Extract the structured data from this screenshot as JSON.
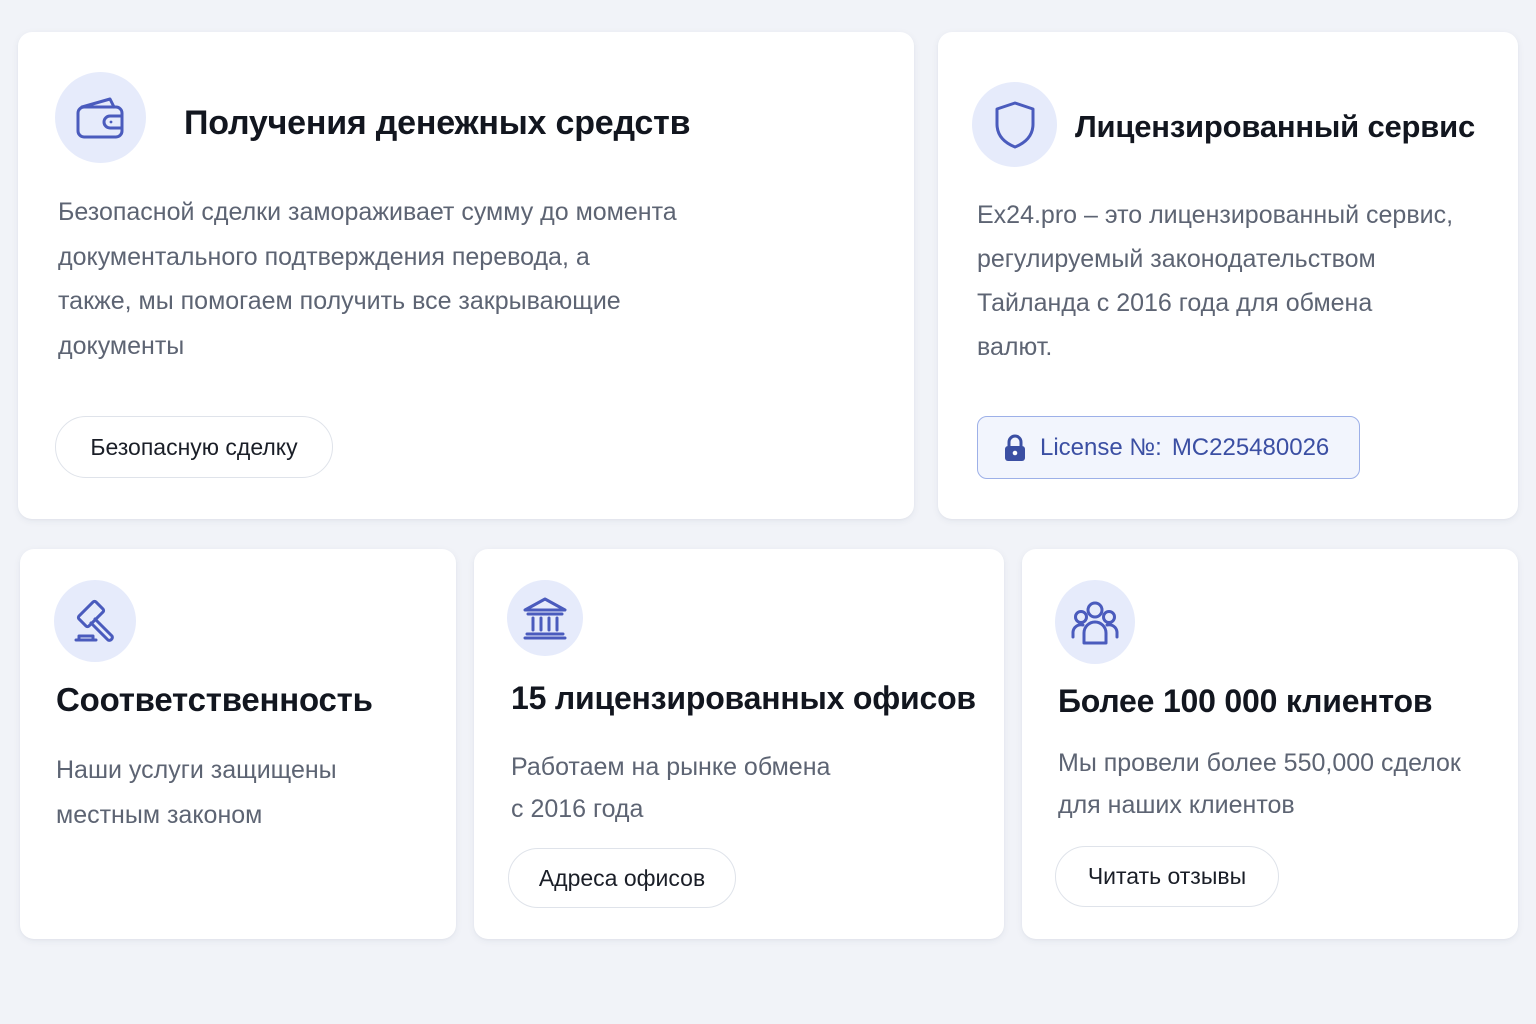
{
  "colors": {
    "background": "#f1f3f8",
    "card": "#ffffff",
    "icon_bg": "#e6ebfb",
    "icon_stroke": "#4a5bbd",
    "license_text": "#3b4fa3",
    "license_border": "#9db0e8"
  },
  "cards": {
    "funds": {
      "icon": "wallet-icon",
      "title": "Получения денежных средств",
      "description_lines": [
        "Безопасной сделки замораживает сумму до момента",
        "документального подтверждения перевода, а",
        "также, мы помогаем получить все закрывающие",
        "документы"
      ],
      "button_label": "Безопасную сделку"
    },
    "licensed": {
      "icon": "shield-icon",
      "title": "Лицензированный сервис",
      "description_lines": [
        "Ex24.pro – это лицензированный сервис,",
        "регулируемый законодательством",
        "Тайланда с 2016 года для обмена",
        "валют."
      ],
      "license_label": "License №:",
      "license_number": "MC225480026",
      "license_icon": "lock-icon"
    },
    "compliance": {
      "icon": "gavel-icon",
      "title": "Соответственность",
      "description_lines": [
        "Наши услуги защищены",
        "местным законом"
      ]
    },
    "offices": {
      "icon": "bank-icon",
      "title": "15 лицензированных офисов",
      "description_lines": [
        "Работаем на рынке обмена",
        "с 2016 года"
      ],
      "button_label": "Адреса офисов"
    },
    "clients": {
      "icon": "users-icon",
      "title": "Более 100 000 клиентов",
      "description_lines": [
        "Мы провели более 550,000 сделок",
        "для наших клиентов"
      ],
      "button_label": "Читать отзывы"
    }
  }
}
